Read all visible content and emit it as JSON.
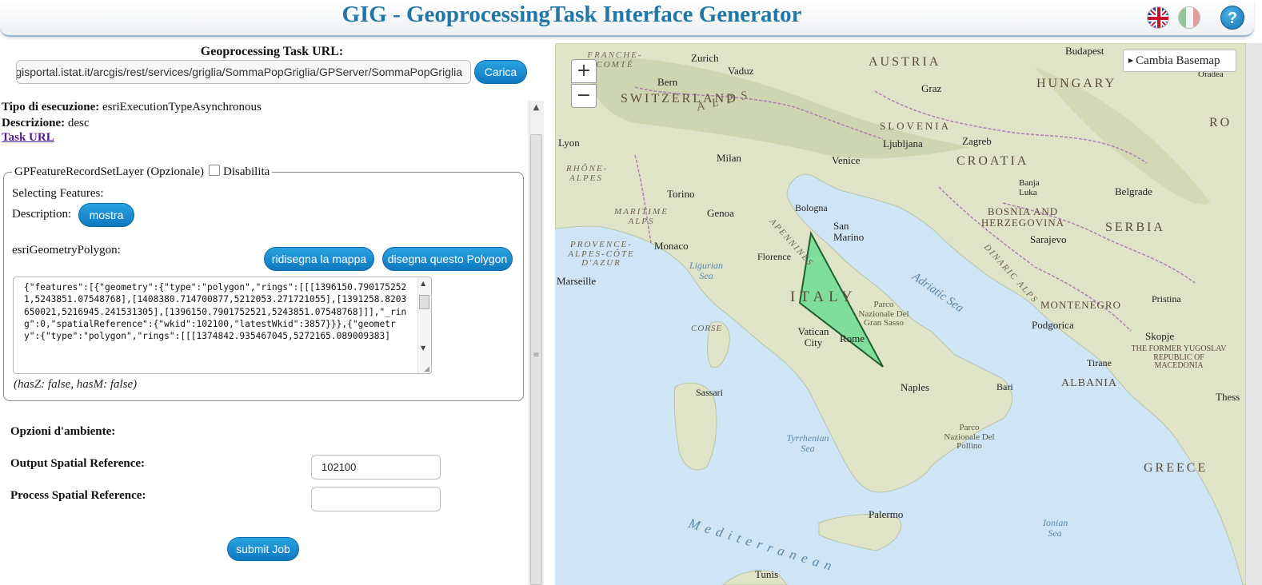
{
  "header": {
    "title": "GIG - GeoprocessingTask Interface Generator",
    "help_label": "?",
    "flags": [
      "uk-flag-icon",
      "italy-flag-icon"
    ]
  },
  "task": {
    "url_label": "Geoprocessing Task URL:",
    "url_value": "http://gisportal.istat.it/arcgis/rest/services/griglia/SommaPopGriglia/GPServer/SommaPopGriglia",
    "load_button": "Carica",
    "execution_label": "Tipo di esecuzione:",
    "execution_value": "esriExecutionTypeAsynchronous",
    "description_label": "Descrizione:",
    "description_value": "desc",
    "task_url_link": "Task URL"
  },
  "parameter": {
    "legend": "GPFeatureRecordSetLayer (Opzionale)",
    "disable_label": "Disabilita",
    "disable_checked": false,
    "selecting_text": "Selecting Features:",
    "description_label": "Description:",
    "show_button": "mostra",
    "geometry_label": "esriGeometryPolygon:",
    "redraw_button": "ridisegna la mappa",
    "draw_button": "disegna questo Polygon",
    "json_value": "{\"features\":[{\"geometry\":{\"type\":\"polygon\",\"rings\":[[[1396150.7901752521,5243851.07548768],[1408380.714700877,5212053.271721055],[1391258.8203650021,5216945.241531305],[1396150.7901752521,5243851.07548768]]],\"_ring\":0,\"spatialReference\":{\"wkid\":102100,\"latestWkid\":3857}}},{\"geometry\":{\"type\":\"polygon\",\"rings\":[[[1374842.935467045,5272165.089009383]",
    "hasz_text": "(hasZ: false, hasM: false)"
  },
  "environment": {
    "title": "Opzioni d'ambiente:",
    "output_sr_label": "Output Spatial Reference:",
    "output_sr_value": "102100",
    "process_sr_label": "Process Spatial Reference:",
    "process_sr_value": "",
    "submit_button": "submit Job"
  },
  "map": {
    "zoom_in": "+",
    "zoom_out": "−",
    "basemap_button": "Cambia Basemap",
    "polygon_fill": "#5fdc8a",
    "polygon_stroke": "#1f5f2f",
    "countries": [
      "AUSTRIA",
      "HUNGARY",
      "SWITZERLAND",
      "SLOVENIA",
      "CROATIA",
      "BOSNIA AND HERZEGOVINA",
      "SERBIA",
      "MONTENEGRO",
      "ALBANIA",
      "ITALY",
      "GREECE",
      "THE FORMER YUGOSLAV REPUBLIC OF MACEDONIA",
      "RO"
    ],
    "cities": [
      "Zurich",
      "Vaduz",
      "Bern",
      "Lyon",
      "Milan",
      "Venice",
      "Ljubljana",
      "Zagreb",
      "Graz",
      "Budapest",
      "Oradea",
      "Torino",
      "Genoa",
      "Bologna",
      "San Marino",
      "Monaco",
      "Florence",
      "Marseille",
      "Banja Luka",
      "Belgrade",
      "Sarajevo",
      "Podgorica",
      "Pristina",
      "Skopje",
      "Tirane",
      "Bari",
      "Naples",
      "Vatican City",
      "Rome",
      "Sassari",
      "Palermo",
      "Tunis",
      "Thess"
    ],
    "seas": [
      "Ligurian Sea",
      "Adriatic Sea",
      "Tyrrhenian Sea",
      "Mediterranean",
      "Ionian Sea"
    ],
    "regions": [
      "FRANCHE-COMTÉ",
      "RHÔNE-ALPES",
      "MARITIME ALPS",
      "PROVENCE-ALPES-CÔTE D'AZUR",
      "CORSE",
      "APENNINES",
      "DINARIC ALPS",
      "ALPS"
    ],
    "parks": [
      "Parco Nazionale Del Gran Sasso",
      "Parco Nazionale Del Pollino"
    ]
  }
}
